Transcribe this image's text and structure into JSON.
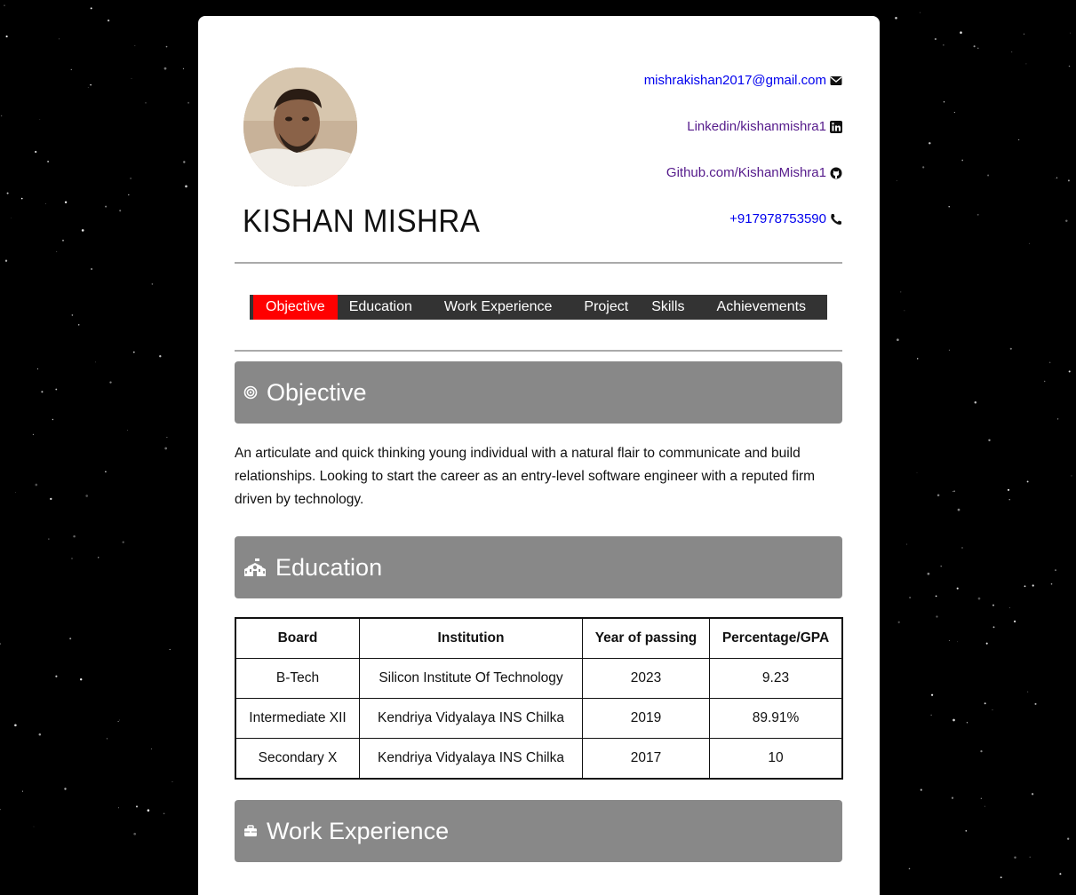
{
  "profile": {
    "name": "KISHAN MISHRA",
    "avatar_alt": "profile photo"
  },
  "contacts": {
    "email": "mishrakishan2017@gmail.com",
    "linkedin": "Linkedin/kishanmishra1",
    "github": "Github.com/KishanMishra1",
    "phone": "+917978753590"
  },
  "nav": {
    "items": [
      "Objective",
      "Education",
      "Work Experience",
      "Project",
      "Skills",
      "Achievements"
    ],
    "active": "Objective"
  },
  "sections": {
    "objective": {
      "title": "Objective",
      "text": "An articulate and quick thinking young individual with a natural flair to communicate and build relationships. Looking to start the career as an entry-level software engineer with a reputed firm driven by technology."
    },
    "education": {
      "title": "Education",
      "headers": [
        "Board",
        "Institution",
        "Year of passing",
        "Percentage/GPA"
      ],
      "rows": [
        [
          "B-Tech",
          "Silicon Institute Of Technology",
          "2023",
          "9.23"
        ],
        [
          "Intermediate XII",
          "Kendriya Vidyalaya INS Chilka",
          "2019",
          "89.91%"
        ],
        [
          "Secondary X",
          "Kendriya Vidyalaya INS Chilka",
          "2017",
          "10"
        ]
      ]
    },
    "work": {
      "title": "Work Experience"
    }
  },
  "colors": {
    "accent_active": "#ff0000",
    "nav_bg": "#333333",
    "section_bg": "#888888",
    "link": "#0000ee",
    "visited_link": "#551a8b"
  },
  "icons": {
    "email": "envelope-icon",
    "linkedin": "linkedin-icon",
    "github": "github-icon",
    "phone": "phone-icon",
    "objective": "bullseye-icon",
    "education": "school-icon",
    "work": "briefcase-icon"
  }
}
